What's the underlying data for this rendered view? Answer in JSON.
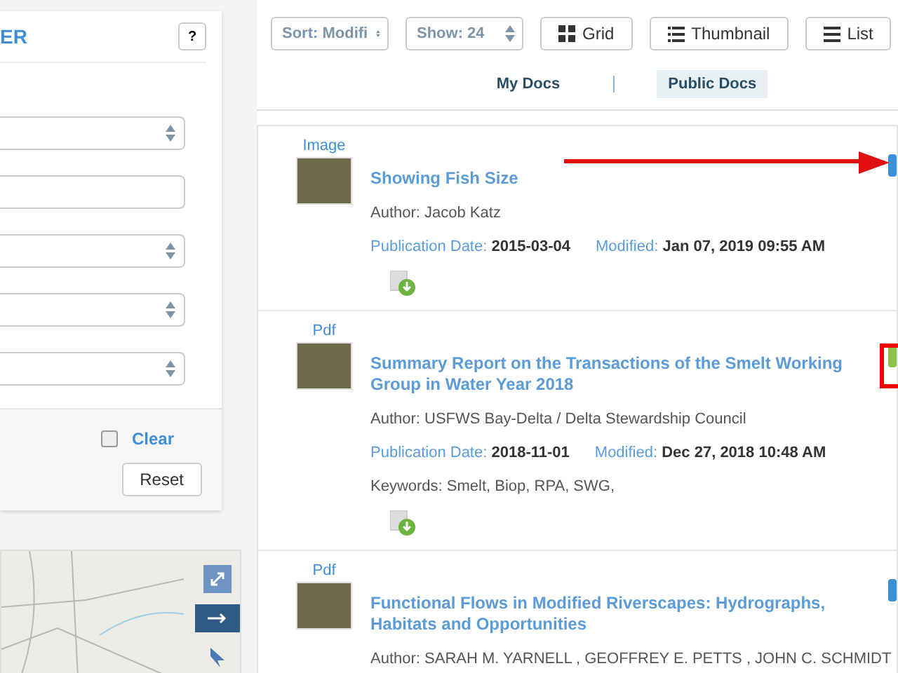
{
  "filter_panel": {
    "title": "ER",
    "help_button": "?",
    "fields": [
      {
        "kind": "select"
      },
      {
        "kind": "text"
      },
      {
        "kind": "select"
      },
      {
        "kind": "select"
      },
      {
        "kind": "select"
      }
    ],
    "clear": {
      "label": "Clear",
      "checked": false
    },
    "reset_button": "Reset"
  },
  "toolbar": {
    "sort": "Sort: Modifi",
    "show": "Show: 24",
    "views": [
      {
        "kind": "grid",
        "label": "Grid",
        "selected": false
      },
      {
        "kind": "thumbnail",
        "label": "Thumbnail",
        "selected": false
      },
      {
        "kind": "list",
        "label": "List",
        "selected": false
      }
    ]
  },
  "tabs": [
    {
      "label": "My Docs",
      "selected": false
    },
    {
      "label": "Public Docs",
      "selected": true
    }
  ],
  "results": [
    {
      "type": "Image",
      "title": "Showing Fish Size",
      "author": "Author: Jacob Katz",
      "pub_label": "Publication Date:",
      "pub_date": "2015-03-04",
      "mod_label": "Modified:",
      "modified": "Jan 07, 2019 09:55 AM",
      "color": "#3f8fd8"
    },
    {
      "type": "Pdf",
      "title": "Summary Report on the Transactions of the Smelt Working Group in Water Year 2018",
      "author": "Author: USFWS Bay-Delta / Delta Stewardship Council",
      "pub_label": "Publication Date:",
      "pub_date": "2018-11-01",
      "mod_label": "Modified:",
      "modified": "Dec 27, 2018 10:48 AM",
      "keywords": "Keywords: Smelt, Biop, RPA, SWG,",
      "color": "#8bc34a"
    },
    {
      "type": "Pdf",
      "title": "Functional Flows in Modified Riverscapes: Hydrographs, Habitats and Opportunities",
      "author": "Author: SARAH M. YARNELL , GEOFFREY E. PETTS , JOHN C. SCHMIDT",
      "color": "#3f8fd8"
    }
  ]
}
